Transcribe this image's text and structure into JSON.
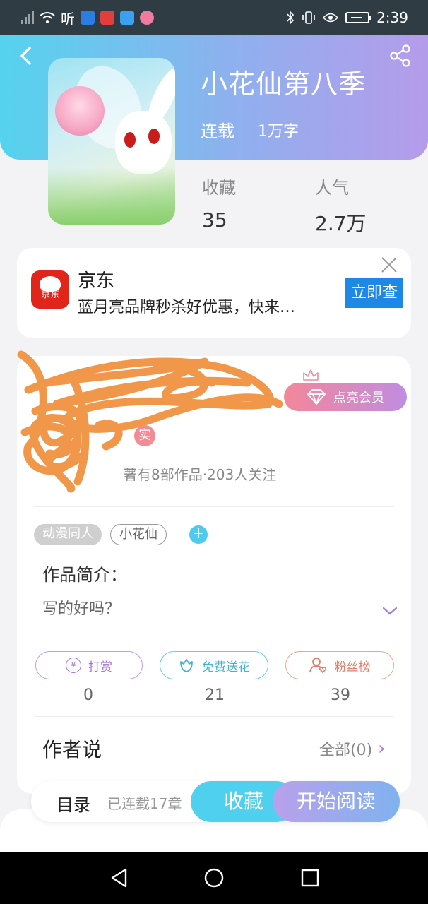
{
  "status_bar": {
    "left_text": "听",
    "time": "2:39"
  },
  "book": {
    "title": "小花仙第八季",
    "status": "连载",
    "words": "1万字",
    "favorites_label": "收藏",
    "favorites_value": "35",
    "popularity_label": "人气",
    "popularity_value": "2.7万"
  },
  "ad": {
    "logo_text": "京东",
    "brand": "京东",
    "description": "蓝月亮品牌秒杀好优惠，快来…",
    "cta": "立即查"
  },
  "author": {
    "vip_button": "点亮会员",
    "real_badge": "实",
    "info": "著有8部作品·203人关注"
  },
  "tags": [
    "动漫同人",
    "小花仙"
  ],
  "intro": {
    "title": "作品简介：",
    "text": "写的好吗？"
  },
  "actions": {
    "tip_label": "打赏",
    "tip_icon": "¥",
    "tip_count": "0",
    "flower_label": "免费送花",
    "flower_count": "21",
    "fans_label": "粉丝榜",
    "fans_count": "39"
  },
  "author_say": {
    "title": "作者说",
    "all_label": "全部(0)"
  },
  "bottom": {
    "toc": "目录",
    "serial": "已连载17章",
    "collect": "收藏",
    "read": "开始阅读"
  },
  "colors": {
    "header_start": "#55d3ee",
    "header_end": "#b59cea",
    "vip_start": "#f3879a",
    "vip_end": "#c08de0",
    "ad_cta": "#1e88e5"
  }
}
